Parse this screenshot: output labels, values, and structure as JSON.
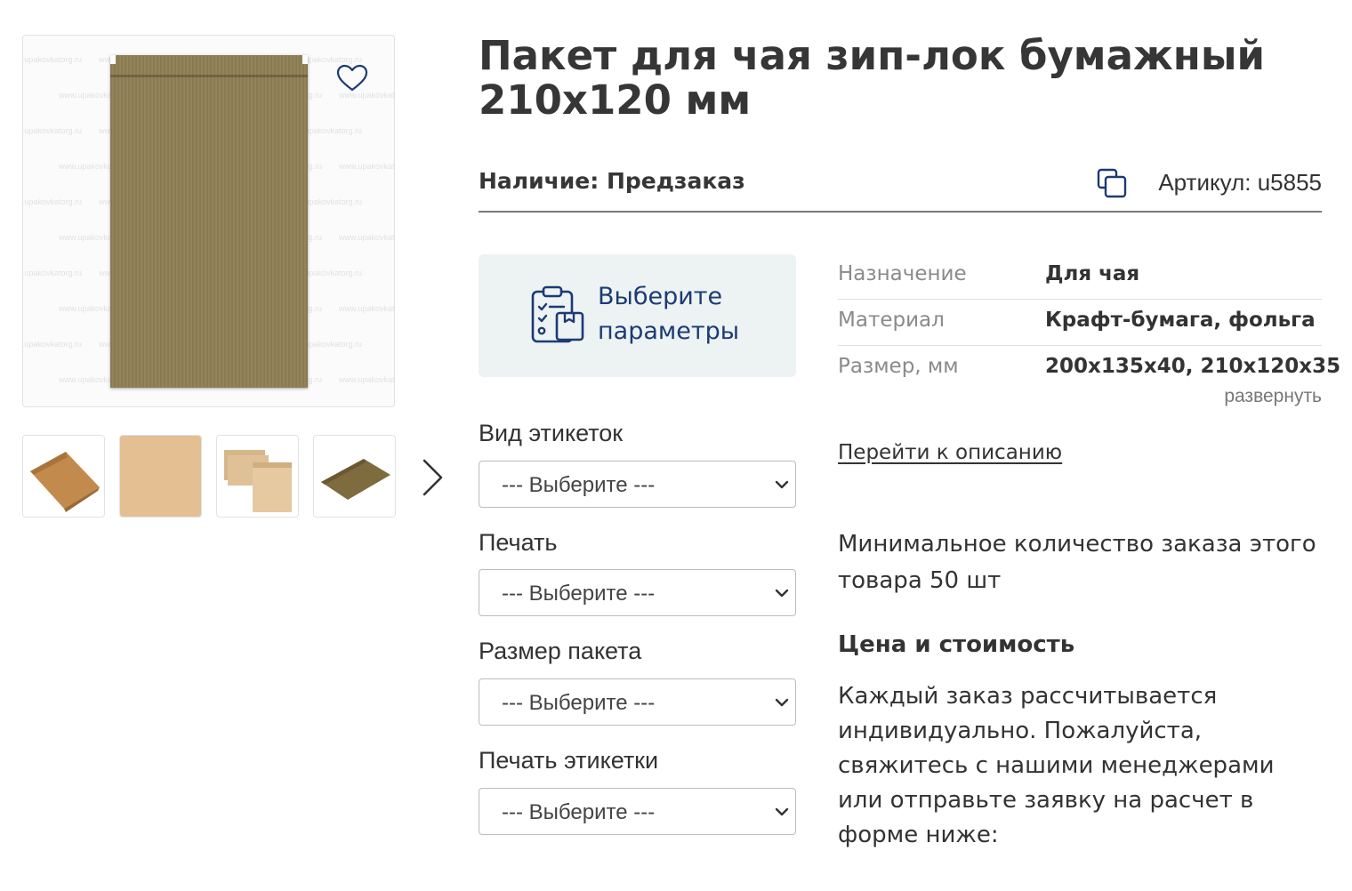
{
  "product": {
    "title": "Пакет для чая зип-лок бумажный 210x120 мм",
    "availability": "Наличие: Предзаказ",
    "sku": "Артикул: u5855",
    "watermark": "www.upakovkatorg.ru"
  },
  "gallery": {
    "thumbs": [
      {
        "name": "thumb-1"
      },
      {
        "name": "thumb-2"
      },
      {
        "name": "thumb-3"
      },
      {
        "name": "thumb-4"
      }
    ],
    "icons": {
      "favorite": "heart-icon",
      "next": "chevron-right-icon"
    }
  },
  "params_box": {
    "line1": "Выберите",
    "line2": "параметры",
    "icon": "checklist-icon"
  },
  "options": [
    {
      "label": "Вид этикеток",
      "value": "--- Выберите ---"
    },
    {
      "label": "Печать",
      "value": "--- Выберите ---"
    },
    {
      "label": "Размер пакета",
      "value": "--- Выберите ---"
    },
    {
      "label": "Печать этикетки",
      "value": "--- Выберите ---"
    }
  ],
  "specs": [
    {
      "name": "Назначение",
      "value": "Для чая"
    },
    {
      "name": "Материал",
      "value": "Крафт-бумага, фольга"
    },
    {
      "name": "Размер, мм",
      "value": "200x135x40, 210x120x35"
    }
  ],
  "expand_label": "развернуть",
  "goto_description": "Перейти к описанию",
  "min_order": "Минимальное количество заказа этого товара 50 шт",
  "price": {
    "heading": "Цена и стоимость",
    "text": "Каждый заказ рассчитывается индивидуально. Пожалуйста, свяжитесь с нашими менеджерами или отправьте заявку на расчет в форме ниже:"
  },
  "colors": {
    "accent": "#1c3a74",
    "params_bg": "#edf2f3",
    "kraft": "#8a7a52"
  }
}
